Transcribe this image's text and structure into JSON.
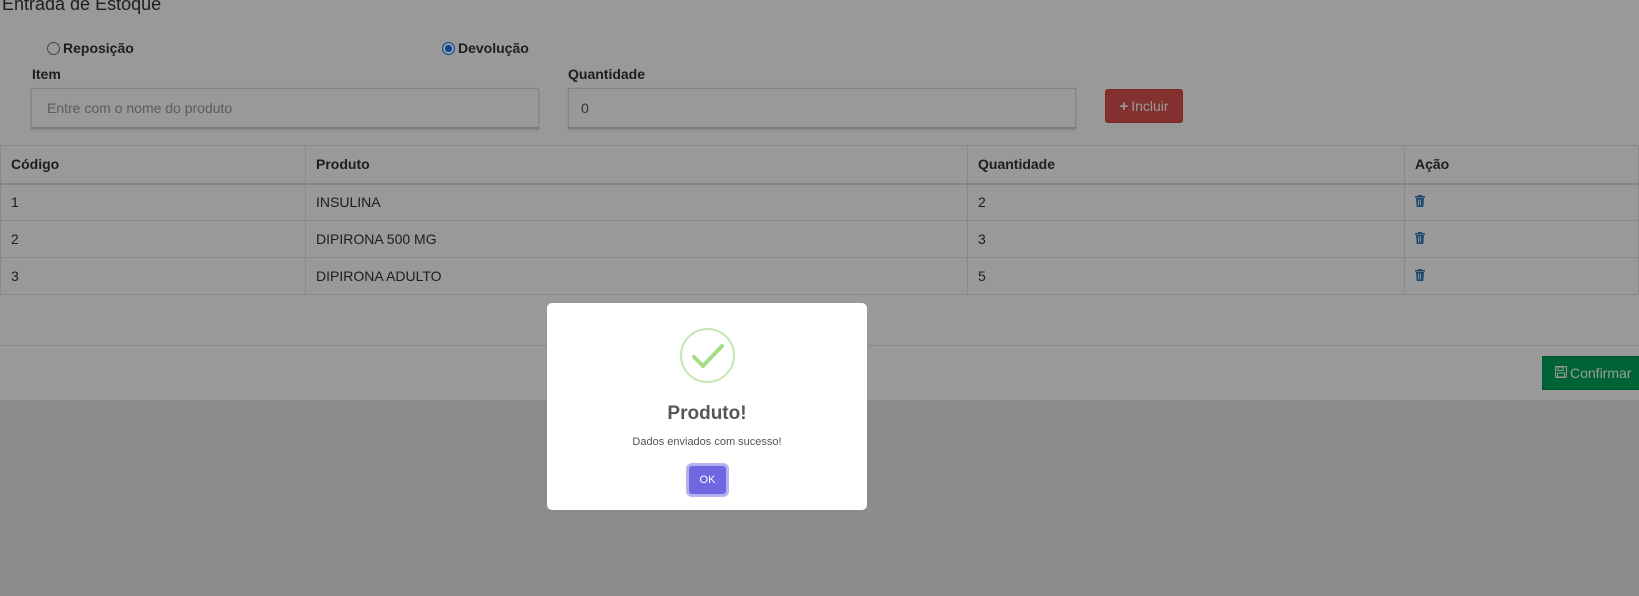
{
  "page": {
    "title": "Entrada de Estoque",
    "radios": [
      {
        "label": "Reposição",
        "checked": false
      },
      {
        "label": "Devolução",
        "checked": true
      }
    ],
    "item_label": "Item",
    "item_placeholder": "Entre com o nome do produto",
    "quantity_label": "Quantidade",
    "quantity_value": "0",
    "add_button": "Incluir",
    "confirm_button": "Confirmar"
  },
  "table": {
    "headers": [
      "Código",
      "Produto",
      "Quantidade",
      "Ação"
    ],
    "rows": [
      {
        "code": "1",
        "product": "INSULINA",
        "qty": "2",
        "action_icon": "trash-icon"
      },
      {
        "code": "2",
        "product": "DIPIRONA 500 MG",
        "qty": "3",
        "action_icon": "trash-icon"
      },
      {
        "code": "3",
        "product": "DIPIRONA ADULTO",
        "qty": "5",
        "action_icon": "trash-icon"
      }
    ]
  },
  "modal": {
    "icon": "success-check-icon",
    "title": "Produto!",
    "text": "Dados enviados com sucesso!",
    "ok_button": "OK"
  },
  "colors": {
    "danger": "#d9534f",
    "success": "#00a65a",
    "link_blue": "#337ab7",
    "ok_button": "#7066e0",
    "check_green": "#a5dc86"
  }
}
